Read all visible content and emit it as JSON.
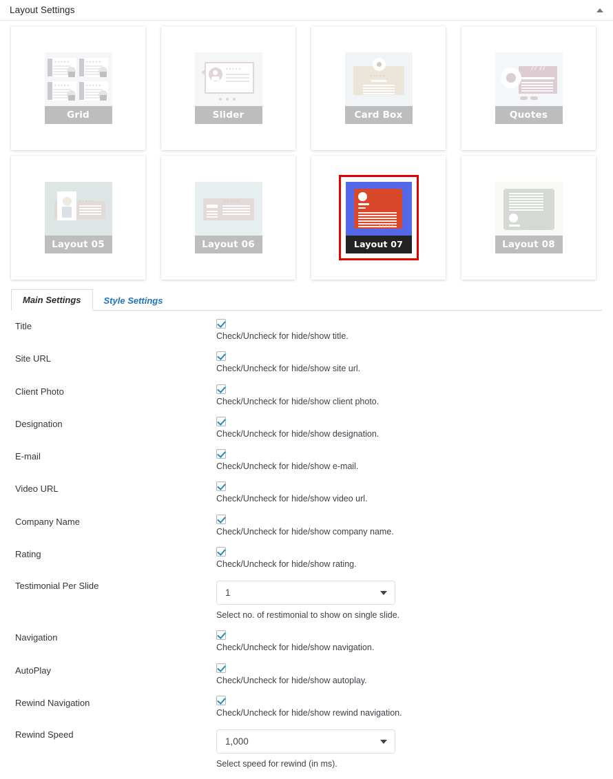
{
  "panel": {
    "title": "Layout Settings",
    "toggle_icon": "chevron-up-icon"
  },
  "gallery": {
    "rows": [
      [
        {
          "id": "grid",
          "label": "Grid",
          "selected": false,
          "bg": "#e3f2fb",
          "accent": "#b9c2d6"
        },
        {
          "id": "slider",
          "label": "Slider",
          "selected": false,
          "bg": "#e3f2fb",
          "accent": "#f9a8c8"
        },
        {
          "id": "cardbox",
          "label": "Card Box",
          "selected": false,
          "bg": "#dbeefb",
          "accent": "#f8cf8f"
        },
        {
          "id": "quotes",
          "label": "Quotes",
          "selected": false,
          "bg": "#e3f4fd",
          "accent": "#f59ab4"
        }
      ],
      [
        {
          "id": "layout05",
          "label": "Layout 05",
          "selected": false,
          "bg": "#a8dcd4",
          "accent": "#eab8a6"
        },
        {
          "id": "layout06",
          "label": "Layout 06",
          "selected": false,
          "bg": "#bfe6f5",
          "accent": "#eeb6a3"
        },
        {
          "id": "layout07",
          "label": "Layout 07",
          "selected": true,
          "bg": "#5468e8",
          "accent": "#d9472b"
        },
        {
          "id": "layout08",
          "label": "Layout 08",
          "selected": false,
          "bg": "#f5f3dd",
          "accent": "#aec2a0"
        }
      ]
    ],
    "selected_border_color": "#e50000"
  },
  "tabs": [
    {
      "id": "main-settings",
      "label": "Main Settings",
      "active": true
    },
    {
      "id": "style-settings",
      "label": "Style Settings",
      "active": false
    }
  ],
  "form": {
    "rows": [
      {
        "id": "title",
        "label": "Title",
        "type": "checkbox",
        "checked": true,
        "help": "Check/Uncheck for hide/show title."
      },
      {
        "id": "site-url",
        "label": "Site URL",
        "type": "checkbox",
        "checked": true,
        "help": "Check/Uncheck for hide/show site url."
      },
      {
        "id": "client-photo",
        "label": "Client Photo",
        "type": "checkbox",
        "checked": true,
        "help": "Check/Uncheck for hide/show client photo."
      },
      {
        "id": "designation",
        "label": "Designation",
        "type": "checkbox",
        "checked": true,
        "help": "Check/Uncheck for hide/show designation."
      },
      {
        "id": "email",
        "label": "E-mail",
        "type": "checkbox",
        "checked": true,
        "help": "Check/Uncheck for hide/show e-mail."
      },
      {
        "id": "video-url",
        "label": "Video URL",
        "type": "checkbox",
        "checked": true,
        "help": "Check/Uncheck for hide/show video url."
      },
      {
        "id": "company-name",
        "label": "Company Name",
        "type": "checkbox",
        "checked": true,
        "help": "Check/Uncheck for hide/show company name."
      },
      {
        "id": "rating",
        "label": "Rating",
        "type": "checkbox",
        "checked": true,
        "help": "Check/Uncheck for hide/show rating."
      },
      {
        "id": "testimonial-per-slide",
        "label": "Testimonial Per Slide",
        "type": "select",
        "value": "1",
        "help": "Select no. of restimonial to show on single slide."
      },
      {
        "id": "navigation",
        "label": "Navigation",
        "type": "checkbox",
        "checked": true,
        "help": "Check/Uncheck for hide/show navigation."
      },
      {
        "id": "autoplay",
        "label": "AutoPlay",
        "type": "checkbox",
        "checked": true,
        "help": "Check/Uncheck for hide/show autoplay."
      },
      {
        "id": "rewind-navigation",
        "label": "Rewind Navigation",
        "type": "checkbox",
        "checked": true,
        "help": "Check/Uncheck for hide/show rewind navigation."
      },
      {
        "id": "rewind-speed",
        "label": "Rewind Speed",
        "type": "select",
        "value": "1,000",
        "help": "Select speed for rewind (in ms)."
      }
    ]
  }
}
